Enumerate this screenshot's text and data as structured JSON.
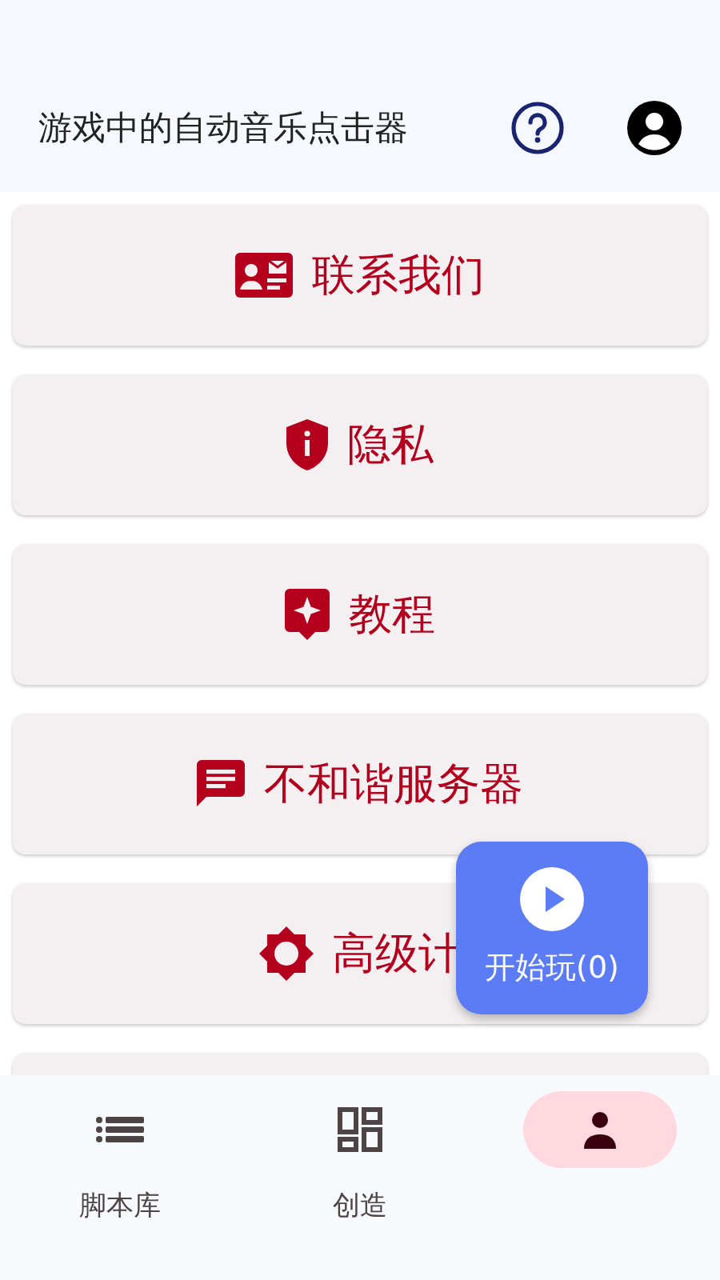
{
  "app_bar": {
    "title": "游戏中的自动音乐点击器"
  },
  "menu_items": [
    {
      "kind": "contact",
      "label": "联系我们"
    },
    {
      "kind": "privacy",
      "label": "隐私"
    },
    {
      "kind": "tutorial",
      "label": "教程"
    },
    {
      "kind": "server",
      "label": "不和谐服务器"
    },
    {
      "kind": "advanced",
      "label": "高级计"
    }
  ],
  "play_button": {
    "label": "开始玩(0)"
  },
  "bottom_nav": [
    {
      "kind": "scripts",
      "label": "脚本库",
      "selected": false
    },
    {
      "kind": "create",
      "label": "创造",
      "selected": false
    },
    {
      "kind": "profile",
      "selected": true
    }
  ]
}
